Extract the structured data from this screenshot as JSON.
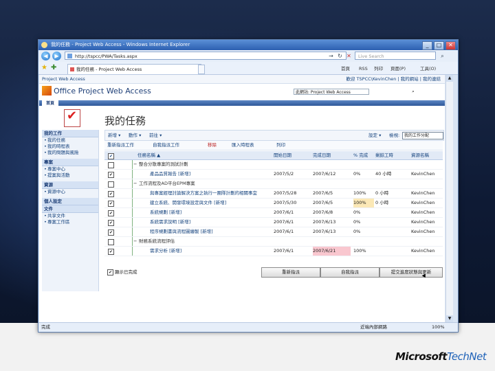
{
  "window": {
    "title": "我的任務 - Project Web Access - Windows Internet Explorer",
    "minimize": "_",
    "maximize": "□",
    "close": "✕"
  },
  "address": {
    "url": "http://tspcc/PWA/Tasks.aspx",
    "search_placeholder": "Live Search",
    "back": "◀",
    "forward": "▶",
    "refresh": "↻",
    "stop": "✕",
    "go": "→",
    "search_go": "⌕"
  },
  "tabs": {
    "active_tab": "我的任務 - Project Web Access",
    "commands": [
      "首頁",
      "RSS",
      "列印",
      "頁面(P)",
      "工具(O)"
    ]
  },
  "pwa": {
    "topbar": "Project Web Access",
    "topbar_right": "歡迎 TSPCC\\KevinChen | 我的網站 | 我的連結",
    "brand": "Office Project Web Access",
    "search_label": "此網站: Project Web Access",
    "search_button": "⌕",
    "home_tab": "首頁",
    "page_title": "我的任務"
  },
  "leftnav": {
    "sections": [
      {
        "header": "我的工作",
        "items": [
          "我的任務",
          "我的時程表",
          "我的問題與風險"
        ]
      },
      {
        "header": "專案",
        "items": [
          "專案中心",
          "提案與活動"
        ]
      },
      {
        "header": "資源",
        "items": [
          "資源中心"
        ]
      },
      {
        "header": "個人設定",
        "items": []
      },
      {
        "header": "文件",
        "items": [
          "共享文件",
          "專案工作區"
        ]
      }
    ]
  },
  "toolbar": {
    "new": "新增 ▾",
    "actions": "動作 ▾",
    "go_to": "前往 ▾",
    "settings": "設定 ▾",
    "view_label": "檢視:",
    "view_value": "我的工作分配",
    "secondary": [
      "重新指派工作",
      "自我指派工作",
      "移除",
      "匯入時程表",
      "列印"
    ]
  },
  "grid": {
    "headers": [
      "任務名稱 ▲",
      "開始日期",
      "完成日期",
      "% 完成",
      "剩餘工時",
      "資源名稱"
    ],
    "rows": [
      {
        "type": "group",
        "checked": false,
        "name": "整合分散專案的測試計劃",
        "start": "",
        "finish": "",
        "pct": "",
        "remaining": "",
        "resource": ""
      },
      {
        "type": "task",
        "checked": true,
        "name": "產品品質報告 [新增]",
        "start": "2007/5/2",
        "finish": "2007/6/12",
        "pct": "0%",
        "remaining": "40 小時",
        "resource": "KevinChen"
      },
      {
        "type": "group",
        "checked": false,
        "name": "工作流程及AD平台EPM專案",
        "start": "",
        "finish": "",
        "pct": "",
        "remaining": "",
        "resource": ""
      },
      {
        "type": "task",
        "checked": true,
        "name": "與專案經理討論解決方案之執行一團隊計劃的相關事宜",
        "start": "2007/5/28",
        "finish": "2007/6/5",
        "pct": "100%",
        "remaining": "0 小時",
        "resource": "KevinChen"
      },
      {
        "type": "task",
        "checked": true,
        "name": "建立系統、開發環境設定與文件 [新增]",
        "start": "2007/5/30",
        "finish": "2007/6/5",
        "pct": "100%",
        "remaining": "0 小時",
        "resource": "KevinChen"
      },
      {
        "type": "task",
        "checked": true,
        "name": "系統規劃 [新增]",
        "start": "2007/6/1",
        "finish": "2007/6/8",
        "pct": "0%",
        "remaining": "",
        "resource": "KevinChen"
      },
      {
        "type": "task",
        "checked": true,
        "name": "系統需求說明 [新增]",
        "start": "2007/6/1",
        "finish": "2007/6/13",
        "pct": "0%",
        "remaining": "",
        "resource": "KevinChen"
      },
      {
        "type": "task",
        "checked": true,
        "name": "程序規劃書與流程圖繪製 [新增]",
        "start": "2007/6/1",
        "finish": "2007/6/13",
        "pct": "0%",
        "remaining": "",
        "resource": "KevinChen"
      },
      {
        "type": "group",
        "checked": false,
        "name": "財務系統流程評估",
        "start": "",
        "finish": "",
        "pct": "",
        "remaining": "",
        "resource": ""
      },
      {
        "type": "task",
        "checked": true,
        "name": "需求分析 [新增]",
        "start": "2007/6/1",
        "finish": "2007/6/21",
        "pct": "100%",
        "remaining": "",
        "resource": "KevinChen"
      }
    ]
  },
  "bottom": {
    "show_done_label": "顯示已完成",
    "buttons": [
      "重新指派",
      "自我指派",
      "提交進度狀態與更新"
    ]
  },
  "status": {
    "left": "完成",
    "zone": "近端內部網路",
    "zoom": "100%"
  },
  "footer": {
    "brand_ms": "Microsoft",
    "brand_tn": "TechNet"
  }
}
